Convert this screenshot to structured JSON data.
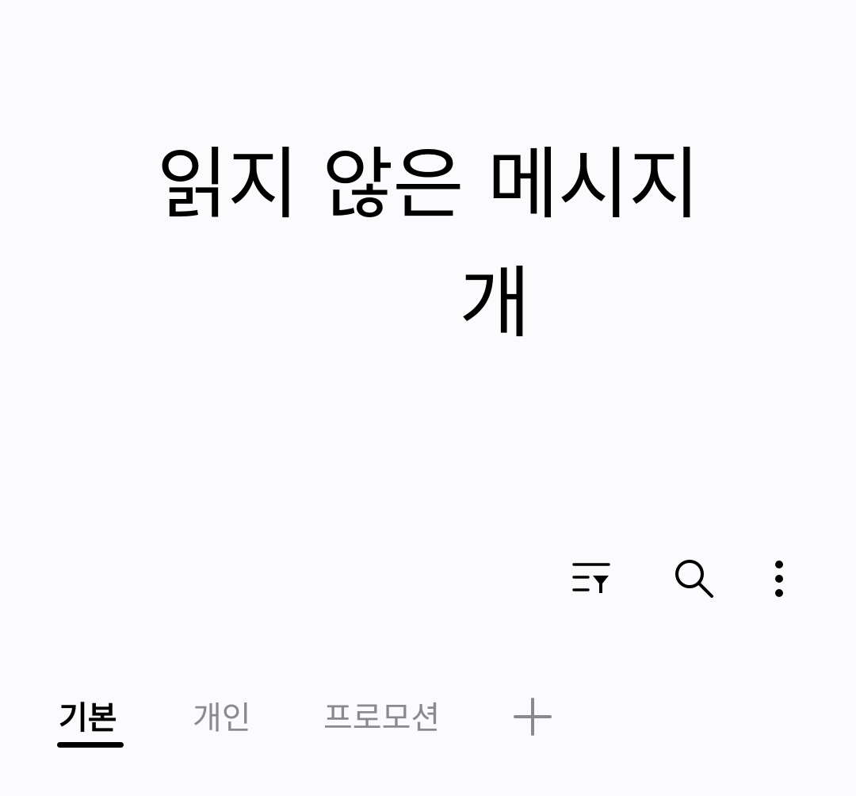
{
  "header": {
    "title_line1": "읽지 않은 메시지",
    "title_line2": "개"
  },
  "toolbar": {
    "filter_icon": "filter-list-icon",
    "search_icon": "search-icon",
    "more_icon": "more-vertical-icon"
  },
  "tabs": {
    "items": [
      {
        "label": "기본",
        "active": true
      },
      {
        "label": "개인",
        "active": false
      },
      {
        "label": "프로모션",
        "active": false
      }
    ],
    "add_icon": "plus-icon"
  },
  "colors": {
    "background": "#fbfbfd",
    "text_primary": "#000000",
    "text_inactive": "#8a8a8c"
  }
}
